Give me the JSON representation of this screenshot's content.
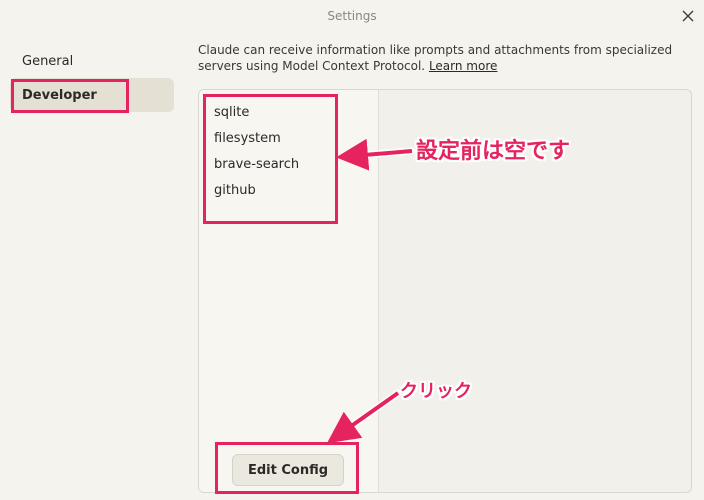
{
  "window": {
    "title": "Settings"
  },
  "sidebar": {
    "items": [
      {
        "label": "General"
      },
      {
        "label": "Developer"
      }
    ]
  },
  "developer": {
    "description": "Claude can receive information like prompts and attachments from specialized servers using Model Context Protocol.",
    "learn_more": "Learn more",
    "servers": [
      "sqlite",
      "filesystem",
      "brave-search",
      "github"
    ],
    "edit_config_label": "Edit Config"
  },
  "annotations": {
    "note_servers": "設定前は空です",
    "note_click": "クリック",
    "color": "#e5235f"
  }
}
